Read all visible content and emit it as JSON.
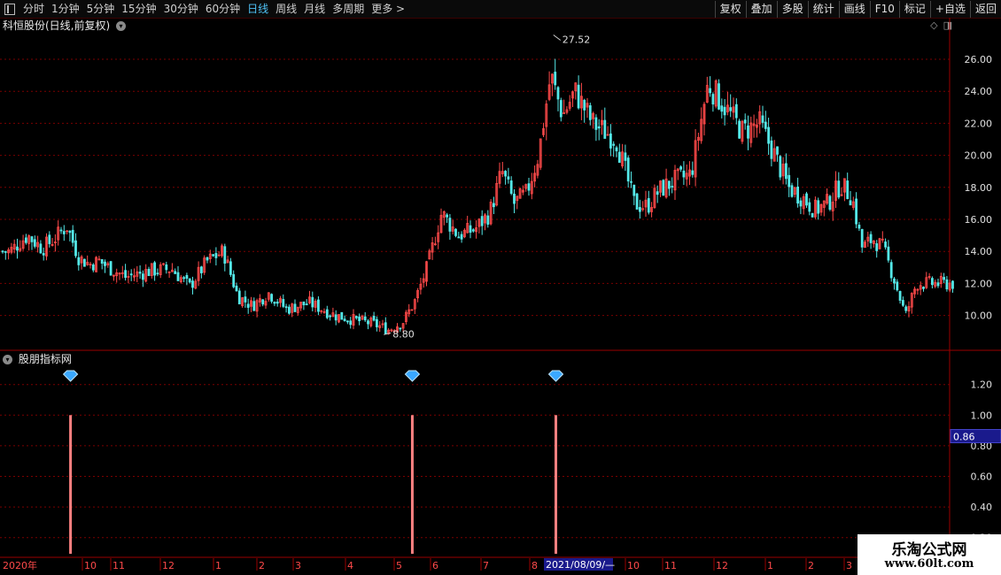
{
  "toolbar": {
    "periods": [
      "分时",
      "1分钟",
      "5分钟",
      "15分钟",
      "30分钟",
      "60分钟",
      "日线",
      "周线",
      "月线",
      "多周期",
      "更多 >"
    ],
    "active_period": "日线",
    "buttons": [
      "复权",
      "叠加",
      "多股",
      "统计",
      "画线",
      "F10",
      "标记",
      "+自选",
      "返回"
    ]
  },
  "main_panel": {
    "title": "科恒股份(日线,前复权)",
    "high_label": "27.52",
    "low_label": "8.80"
  },
  "indicator_panel": {
    "title": "股朋指标网",
    "current_value": "0.86"
  },
  "x_axis": {
    "year_label": "2020年",
    "months": [
      "10",
      "11",
      "12",
      "1",
      "2",
      "3",
      "4",
      "5",
      "6",
      "7",
      "8",
      "10",
      "11",
      "12",
      "1",
      "2",
      "3"
    ],
    "cursor_date": "2021/08/09/—"
  },
  "watermark": {
    "title": "乐淘公式网",
    "url": "www.60lt.com"
  },
  "colors": {
    "up": "#ff4a4a",
    "down": "#54e8e8",
    "grid": "#7a0000",
    "signal": "#ff8080",
    "active_tab": "#4fc3f7"
  },
  "chart_data": [
    {
      "type": "candlestick",
      "title": "科恒股份(日线,前复权)",
      "y_ticks": [
        10,
        12,
        14,
        16,
        18,
        20,
        22,
        24,
        26
      ],
      "ylim": [
        8.0,
        28.5
      ],
      "grid": true,
      "annotations": [
        {
          "label": "27.52",
          "value": 27.52,
          "date": "2021-08"
        },
        {
          "label": "8.80",
          "value": 8.8,
          "date": "2021-04"
        }
      ],
      "close_path": [
        {
          "t": "2020-08",
          "v": 14.0
        },
        {
          "t": "2020-08",
          "v": 15.0
        },
        {
          "t": "2020-09",
          "v": 14.2
        },
        {
          "t": "2020-09",
          "v": 14.8
        },
        {
          "t": "2020-09",
          "v": 15.6
        },
        {
          "t": "2020-09",
          "v": 13.6
        },
        {
          "t": "2020-10",
          "v": 13.2
        },
        {
          "t": "2020-10",
          "v": 13.4
        },
        {
          "t": "2020-10",
          "v": 13.0
        },
        {
          "t": "2020-11",
          "v": 12.4
        },
        {
          "t": "2020-11",
          "v": 12.8
        },
        {
          "t": "2020-12",
          "v": 12.9
        },
        {
          "t": "2020-12",
          "v": 11.8
        },
        {
          "t": "2020-12",
          "v": 13.4
        },
        {
          "t": "2021-01",
          "v": 14.0
        },
        {
          "t": "2021-01",
          "v": 11.2
        },
        {
          "t": "2021-01",
          "v": 10.6
        },
        {
          "t": "2021-02",
          "v": 11.4
        },
        {
          "t": "2021-02",
          "v": 10.4
        },
        {
          "t": "2021-03",
          "v": 10.8
        },
        {
          "t": "2021-03",
          "v": 10.0
        },
        {
          "t": "2021-04",
          "v": 9.7
        },
        {
          "t": "2021-04",
          "v": 9.5
        },
        {
          "t": "2021-04",
          "v": 9.1
        },
        {
          "t": "2021-05",
          "v": 9.6
        },
        {
          "t": "2021-05",
          "v": 10.9
        },
        {
          "t": "2021-05",
          "v": 13.0
        },
        {
          "t": "2021-06",
          "v": 16.4
        },
        {
          "t": "2021-06",
          "v": 15.0
        },
        {
          "t": "2021-06",
          "v": 15.4
        },
        {
          "t": "2021-07",
          "v": 16.4
        },
        {
          "t": "2021-07",
          "v": 19.0
        },
        {
          "t": "2021-07",
          "v": 17.0
        },
        {
          "t": "2021-07",
          "v": 17.6
        },
        {
          "t": "2021-08",
          "v": 20.0
        },
        {
          "t": "2021-08",
          "v": 25.0
        },
        {
          "t": "2021-08",
          "v": 22.5
        },
        {
          "t": "2021-08",
          "v": 24.0
        },
        {
          "t": "2021-09",
          "v": 22.0
        },
        {
          "t": "2021-09",
          "v": 21.0
        },
        {
          "t": "2021-10",
          "v": 17.0
        },
        {
          "t": "2021-10",
          "v": 16.8
        },
        {
          "t": "2021-10",
          "v": 17.8
        },
        {
          "t": "2021-11",
          "v": 18.4
        },
        {
          "t": "2021-11",
          "v": 18.8
        },
        {
          "t": "2021-11",
          "v": 24.5
        },
        {
          "t": "2021-12",
          "v": 23.0
        },
        {
          "t": "2021-12",
          "v": 21.5
        },
        {
          "t": "2021-12",
          "v": 22.0
        },
        {
          "t": "2022-01",
          "v": 20.0
        },
        {
          "t": "2022-01",
          "v": 18.0
        },
        {
          "t": "2022-01",
          "v": 17.4
        },
        {
          "t": "2022-02",
          "v": 16.6
        },
        {
          "t": "2022-02",
          "v": 17.0
        },
        {
          "t": "2022-02",
          "v": 18.2
        },
        {
          "t": "2022-03",
          "v": 17.4
        },
        {
          "t": "2022-03",
          "v": 14.2
        },
        {
          "t": "2022-03",
          "v": 14.8
        },
        {
          "t": "2022-04",
          "v": 14.2
        },
        {
          "t": "2022-04",
          "v": 12.2
        },
        {
          "t": "2022-04",
          "v": 10.0
        },
        {
          "t": "2022-04",
          "v": 12.0
        }
      ]
    },
    {
      "type": "bar",
      "title": "股朋指标网",
      "y_ticks": [
        0.2,
        0.4,
        0.6,
        0.8,
        1.0,
        1.2
      ],
      "ylim": [
        0.1,
        1.3
      ],
      "grid": true,
      "signals": [
        {
          "date": "2020-09",
          "value": 1.0
        },
        {
          "date": "2021-05",
          "value": 1.0
        },
        {
          "date": "2021-08",
          "value": 1.0
        }
      ],
      "marker": "diamond-icon"
    }
  ]
}
